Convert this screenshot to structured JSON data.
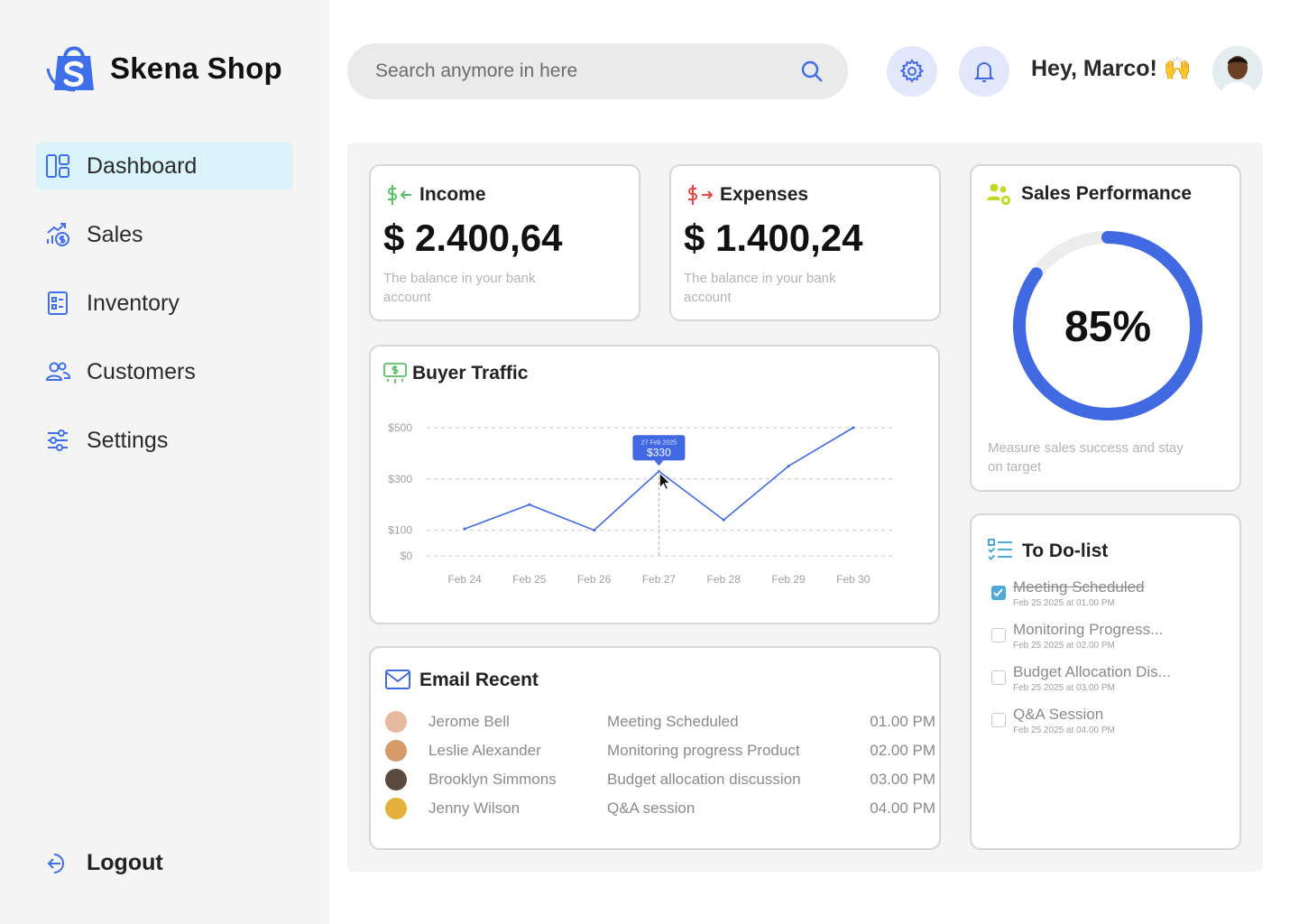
{
  "brand": {
    "name": "Skena Shop"
  },
  "sidebar": {
    "items": [
      {
        "label": "Dashboard",
        "icon": "dashboard-icon",
        "active": true
      },
      {
        "label": "Sales",
        "icon": "sales-icon"
      },
      {
        "label": "Inventory",
        "icon": "inventory-icon"
      },
      {
        "label": "Customers",
        "icon": "customers-icon"
      },
      {
        "label": "Settings",
        "icon": "settings-sliders-icon"
      }
    ],
    "logout": "Logout"
  },
  "header": {
    "search_placeholder": "Search anymore in here",
    "greeting": "Hey, Marco! 🙌"
  },
  "colors": {
    "accent": "#4169e1",
    "active_nav": "#d9f3f8",
    "income": "#5cbf6a",
    "expenses": "#e64545"
  },
  "income": {
    "title": "Income",
    "amount": "$ 2.400,64",
    "note": "The balance in your bank account"
  },
  "expenses": {
    "title": "Expenses",
    "amount": "$ 1.400,24",
    "note": "The balance in your bank account"
  },
  "sales_performance": {
    "title": "Sales Performance",
    "value_text": "85%",
    "percent": 85,
    "note": "Measure sales success and stay on target"
  },
  "buyer_traffic": {
    "title": "Buyer Traffic"
  },
  "chart_data": {
    "type": "line",
    "title": "Buyer Traffic",
    "categories": [
      "Feb 24",
      "Feb 25",
      "Feb 26",
      "Feb 27",
      "Feb 28",
      "Feb 29",
      "Feb 30"
    ],
    "y_ticks": [
      "$500",
      "$300",
      "$100",
      "$0"
    ],
    "values": [
      105,
      200,
      100,
      330,
      140,
      350,
      500
    ],
    "ylim": [
      0,
      500
    ],
    "tooltip": {
      "date": "27 Feb 2025",
      "value": "$330",
      "index": 3
    },
    "grid": true
  },
  "email_recent": {
    "title": "Email Recent",
    "rows": [
      {
        "name": "Jerome Bell",
        "subject": "Meeting Scheduled",
        "time": "01.00 PM"
      },
      {
        "name": "Leslie Alexander",
        "subject": "Monitoring progress Product",
        "time": "02.00 PM"
      },
      {
        "name": "Brooklyn Simmons",
        "subject": "Budget allocation discussion",
        "time": "03.00 PM"
      },
      {
        "name": "Jenny Wilson",
        "subject": "Q&A session",
        "time": "04.00 PM"
      }
    ]
  },
  "todo": {
    "title": "To Do-list",
    "items": [
      {
        "title": "Meeting Scheduled",
        "sub": "Feb 25 2025 at 01.00 PM",
        "done": true
      },
      {
        "title": "Monitoring Progress...",
        "sub": "Feb 25 2025 at 02.00 PM",
        "done": false
      },
      {
        "title": "Budget Allocation Dis...",
        "sub": "Feb 25 2025 at 03.00 PM",
        "done": false
      },
      {
        "title": "Q&A Session",
        "sub": "Feb 25 2025 at 04.00 PM",
        "done": false
      }
    ]
  }
}
